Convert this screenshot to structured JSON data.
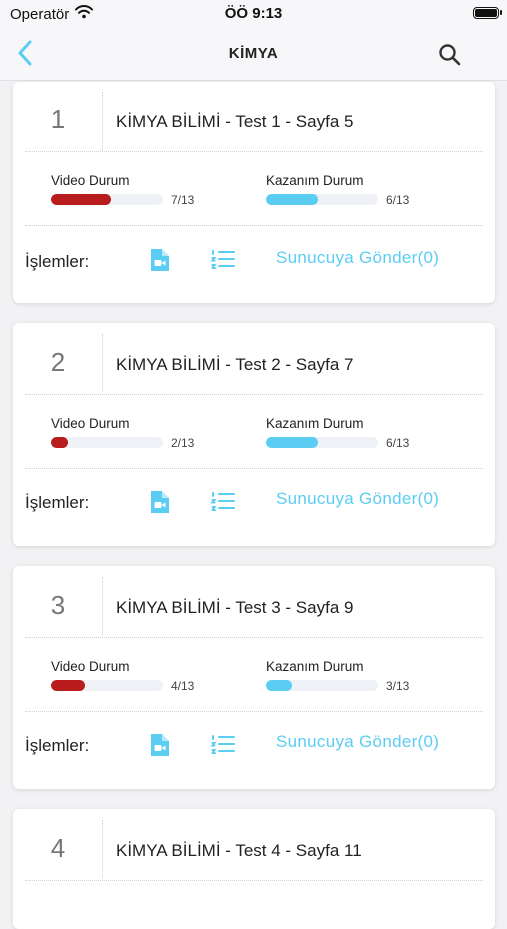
{
  "status_bar": {
    "carrier": "Operatör",
    "time": "ÖÖ 9:13"
  },
  "nav": {
    "title": "KİMYA"
  },
  "colors": {
    "accent": "#5bcdf3",
    "video_bar": "#b81c1c",
    "kazanim_bar": "#5bcdf3"
  },
  "cards": [
    {
      "number": "1",
      "title": "KİMYA BİLİMİ - Test 1 - Sayfa 5",
      "video_label": "Video Durum",
      "video_count": "7/13",
      "video_done": 7,
      "video_total": 13,
      "kazanim_label": "Kazanım Durum",
      "kazanim_count": "6/13",
      "kazanim_done": 6,
      "kazanim_total": 13,
      "ops_label": "İşlemler:",
      "send_label": "Sunucuya Gönder(0)"
    },
    {
      "number": "2",
      "title": "KİMYA BİLİMİ - Test 2 - Sayfa 7",
      "video_label": "Video Durum",
      "video_count": "2/13",
      "video_done": 2,
      "video_total": 13,
      "kazanim_label": "Kazanım Durum",
      "kazanim_count": "6/13",
      "kazanim_done": 6,
      "kazanim_total": 13,
      "ops_label": "İşlemler:",
      "send_label": "Sunucuya Gönder(0)"
    },
    {
      "number": "3",
      "title": "KİMYA BİLİMİ - Test 3 - Sayfa 9",
      "video_label": "Video Durum",
      "video_count": "4/13",
      "video_done": 4,
      "video_total": 13,
      "kazanim_label": "Kazanım Durum",
      "kazanim_count": "3/13",
      "kazanim_done": 3,
      "kazanim_total": 13,
      "ops_label": "İşlemler:",
      "send_label": "Sunucuya Gönder(0)"
    },
    {
      "number": "4",
      "title": "KİMYA BİLİMİ - Test 4 - Sayfa 11"
    }
  ]
}
